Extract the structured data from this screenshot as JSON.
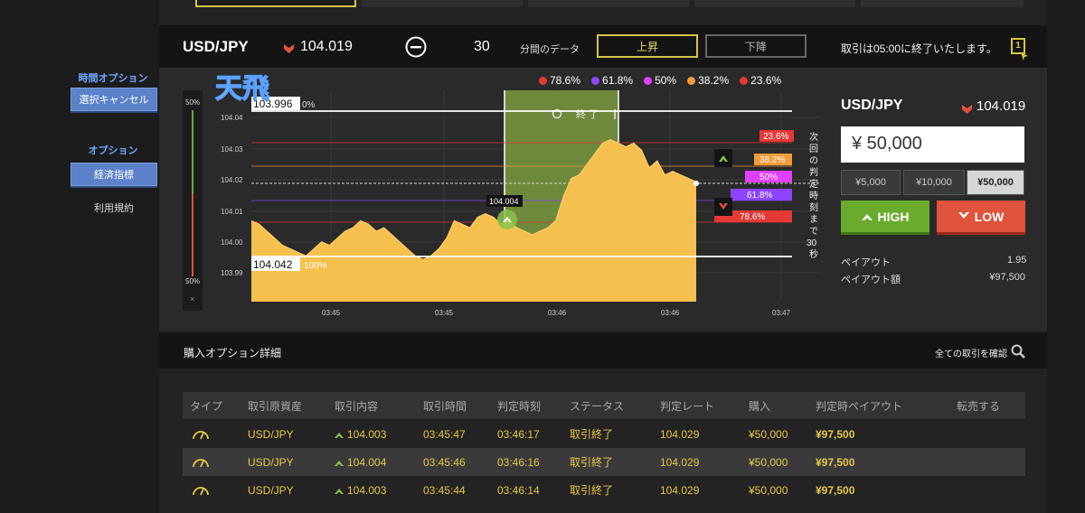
{
  "sidebar": {
    "section_time": "時間オプション",
    "btn_cancel": "選択キャンセル",
    "section_option": "オプション",
    "btn_economic": "経済指標",
    "link_terms": "利用規約"
  },
  "header": {
    "pair": "USD/JPY",
    "price": "104.019",
    "period_value": "30",
    "period_label": "分間のデータ",
    "up_label": "上昇",
    "down_label": "下降",
    "notice": "取引は05:00に終了いたします。",
    "corner_badge": "1"
  },
  "fibo": [
    {
      "label": "78.6%",
      "color": "#e53935"
    },
    {
      "label": "61.8%",
      "color": "#8e44ff"
    },
    {
      "label": "50%",
      "color": "#e040fb"
    },
    {
      "label": "38.2%",
      "color": "#f39c3a"
    },
    {
      "label": "23.6%",
      "color": "#e53935"
    }
  ],
  "chart": {
    "logo_text": "天飛",
    "gauge_top": "50%",
    "gauge_bottom": "50%",
    "gauge_close": "×",
    "high_label": "103.996",
    "high_pct": "0%",
    "low_label": "104.042",
    "low_pct": "100%",
    "end_label": "終 了",
    "marker_value": "104.004",
    "yticks": [
      "104.04",
      "104.03",
      "104.02",
      "104.01",
      "104.00",
      "103.99"
    ],
    "xticks": [
      "03:45",
      "03:45",
      "03:46",
      "03:46",
      "03:47"
    ],
    "fib_tags": [
      "23.6%",
      "38.2%",
      "50%",
      "61.8%",
      "78.6%"
    ],
    "countdown": [
      "次",
      "回",
      "の",
      "判",
      "定",
      "時",
      "刻",
      "ま",
      "で",
      "30",
      "秒"
    ]
  },
  "chart_data": {
    "type": "area",
    "title": "",
    "xlabel": "",
    "ylabel": "",
    "x_ticks": [
      "03:45",
      "03:45",
      "03:46",
      "03:46",
      "03:47"
    ],
    "ylim": [
      103.985,
      104.045
    ],
    "series": [
      {
        "values": [
          104.008,
          104.007,
          104.005,
          104.003,
          104.001,
          104.0,
          103.999,
          103.998,
          104.0,
          104.002,
          104.001,
          104.003,
          104.005,
          104.006,
          104.008,
          104.007,
          104.005,
          104.006,
          104.004,
          104.002,
          104.0,
          103.998,
          103.997,
          103.998,
          104.0,
          104.003,
          104.008,
          104.007,
          104.006,
          104.009,
          104.01,
          104.009,
          104.007,
          104.008,
          104.006,
          104.005,
          104.004,
          104.005,
          104.006,
          104.008,
          104.015,
          104.02,
          104.021,
          104.024,
          104.027,
          104.03,
          104.031,
          104.03,
          104.029,
          104.03,
          104.028,
          104.023,
          104.025,
          104.021,
          104.022,
          104.021,
          104.02,
          104.019
        ]
      }
    ]
  },
  "trade": {
    "pair": "USD/JPY",
    "price": "104.019",
    "amount": "¥ 50,000",
    "presets": [
      "¥5,000",
      "¥10,000",
      "¥50,000"
    ],
    "high_label": "HIGH",
    "low_label": "LOW",
    "payout_label": "ペイアウト",
    "payout_value": "1.95",
    "payout_amount_label": "ペイアウト額",
    "payout_amount_value": "¥97,500"
  },
  "details": {
    "title": "購入オプション詳細",
    "check_all": "全ての取引を確認"
  },
  "table": {
    "headers": [
      "タイプ",
      "取引原資産",
      "取引内容",
      "取引時間",
      "判定時刻",
      "ステータス",
      "判定レート",
      "購入",
      "判定時ペイアウト",
      "転売する"
    ],
    "rows": [
      {
        "asset": "USD/JPY",
        "content": "104.003",
        "time": "03:45:47",
        "judge": "03:46:17",
        "status": "取引終了",
        "rate": "104.029",
        "buy": "¥50,000",
        "payout": "¥97,500"
      },
      {
        "asset": "USD/JPY",
        "content": "104.004",
        "time": "03:45:46",
        "judge": "03:46:16",
        "status": "取引終了",
        "rate": "104.029",
        "buy": "¥50,000",
        "payout": "¥97,500"
      },
      {
        "asset": "USD/JPY",
        "content": "104.003",
        "time": "03:45:44",
        "judge": "03:46:14",
        "status": "取引終了",
        "rate": "104.029",
        "buy": "¥50,000",
        "payout": "¥97,500"
      }
    ]
  },
  "colors": {
    "accent_yellow": "#d5c64a",
    "high_green": "#6aab2e",
    "low_red": "#e0533c",
    "area_fill": "#f6c04f"
  }
}
